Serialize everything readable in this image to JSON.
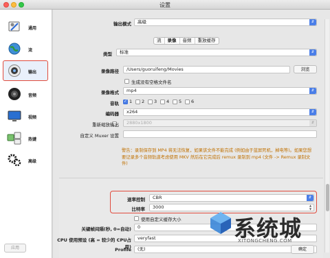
{
  "window": {
    "title": "设置"
  },
  "sidebar": {
    "items": [
      {
        "label": "通用",
        "icon": "gear-general-icon"
      },
      {
        "label": "流",
        "icon": "globe-icon"
      },
      {
        "label": "输出",
        "icon": "output-icon",
        "selected": true
      },
      {
        "label": "音频",
        "icon": "speaker-icon"
      },
      {
        "label": "视频",
        "icon": "monitor-icon"
      },
      {
        "label": "热键",
        "icon": "keyboard-icon"
      },
      {
        "label": "高级",
        "icon": "gears-icon"
      }
    ],
    "apply_label": "应用"
  },
  "output": {
    "mode_label": "输出模式",
    "mode_value": "高级",
    "tabs": [
      {
        "label": "流",
        "active": false
      },
      {
        "label": "录像",
        "active": true
      },
      {
        "label": "音频",
        "active": false
      },
      {
        "label": "重放缓存",
        "active": false
      }
    ],
    "type_label": "类型",
    "type_value": "标准",
    "path_label": "录像路径",
    "path_value": "/Users/guoruifeng/Movies",
    "browse_label": "浏览",
    "no_space_label": "生成没有空格文件名",
    "format_label": "录像格式",
    "format_value": "mp4",
    "track_label": "音轨",
    "tracks": [
      {
        "label": "1",
        "checked": true
      },
      {
        "label": "2",
        "checked": false
      },
      {
        "label": "3",
        "checked": false
      },
      {
        "label": "4",
        "checked": false
      },
      {
        "label": "5",
        "checked": false
      },
      {
        "label": "6",
        "checked": false
      }
    ],
    "encoder_label": "编码器",
    "encoder_value": "x264",
    "rescale_label": "重新缩放输出",
    "rescale_value": "2880x1800",
    "muxer_label": "自定义 Muxer 设置",
    "warning": "警告：录制保存到 MP4 将无法恢复，如果该文件不能完成 (例如由于蓝屏死机，掉电等)。如果您想要记录多个音频轨道考虑使用 MKV 然后在它完成后 remux 录制到 mp4 (文件 -> Remux 录制文件)",
    "rate_control_label": "速率控制",
    "rate_control_value": "CBR",
    "bitrate_label": "比特率",
    "bitrate_value": "3000",
    "custom_buffer_label": "使用自定义缓存大小",
    "keyframe_label": "关键帧间隔(秒, 0=自动)",
    "keyframe_value": "0",
    "cpu_preset_label": "CPU 使用预设 (高 = 较少的 CPU占用)",
    "cpu_preset_value": "veryfast",
    "profile_label": "Profile",
    "profile_value": "(无)"
  },
  "footer": {
    "ok_label": "确定"
  },
  "watermark": {
    "title": "系统城",
    "url": "XITONGCHENG.COM"
  },
  "colors": {
    "accent": "#4a7ee8",
    "highlight_border": "#e04a3c",
    "warning": "#c07000"
  }
}
